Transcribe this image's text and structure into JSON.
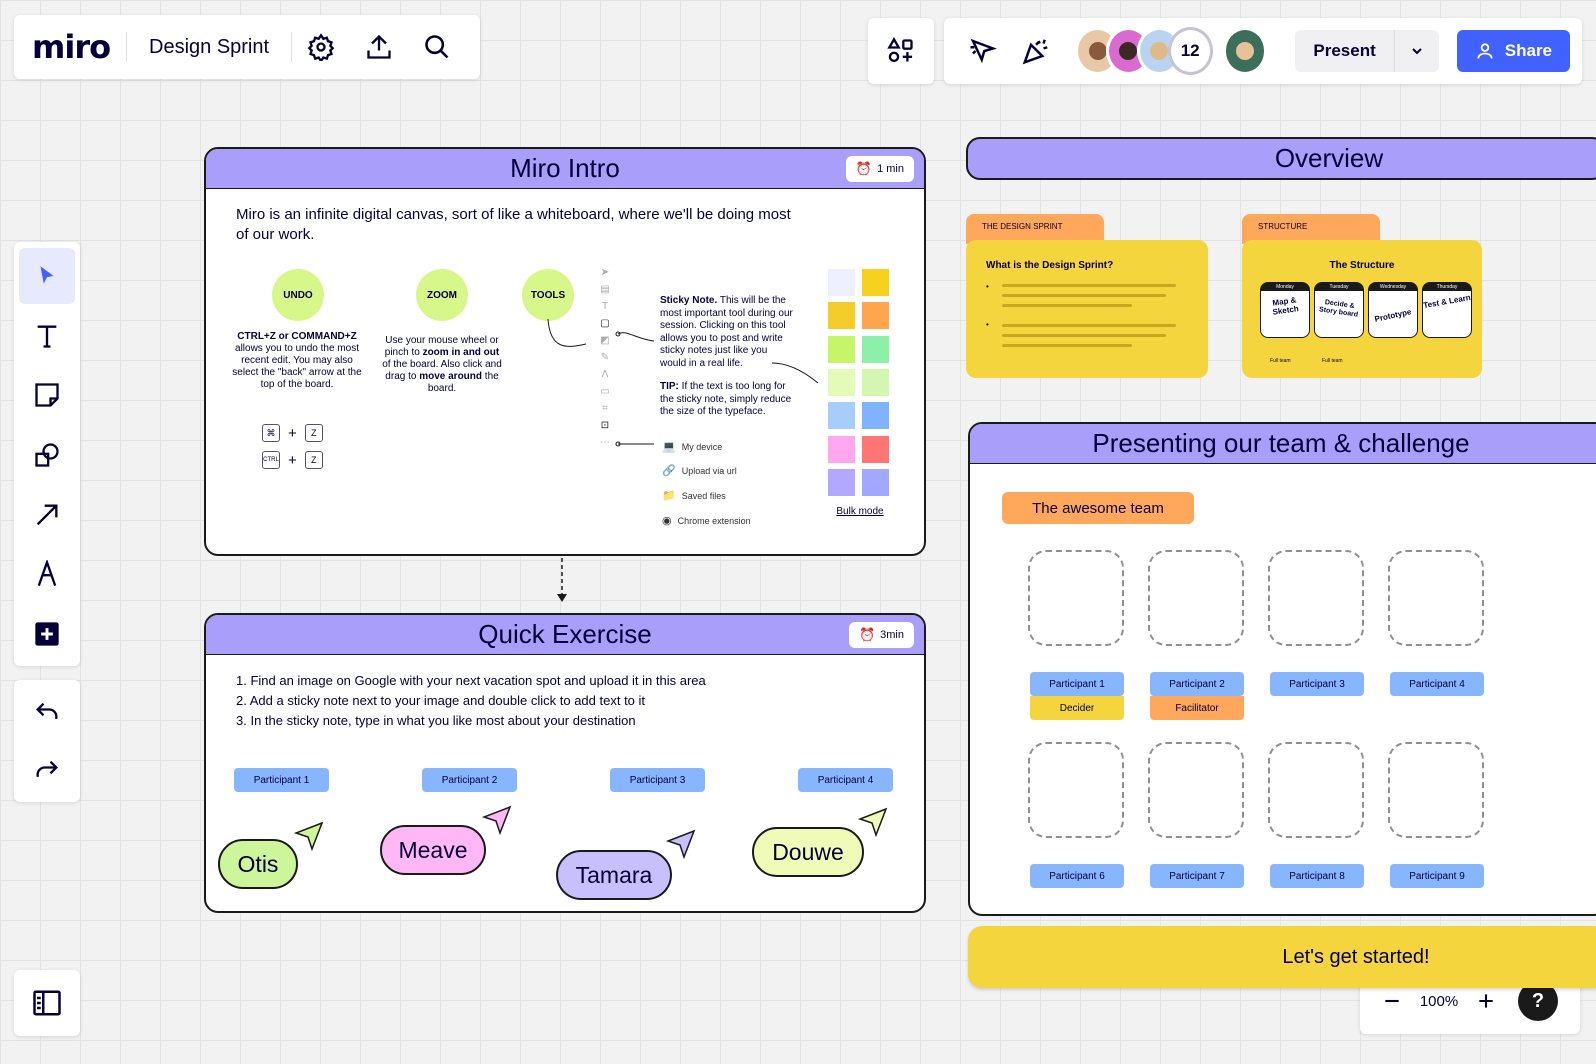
{
  "app": {
    "logo": "miro",
    "board_title": "Design Sprint"
  },
  "header": {
    "participant_count": "12",
    "present_label": "Present",
    "share_label": "Share"
  },
  "zoom": {
    "level": "100%",
    "help": "?"
  },
  "intro_frame": {
    "title": "Miro Intro",
    "timer": "1 min",
    "description": "Miro is an infinite digital canvas, sort of like a whiteboard, where we'll be doing most of our work.",
    "undo": {
      "bubble": "UNDO",
      "shortcut": "CTRL+Z or COMMAND+Z",
      "text": "allows you to undo the most recent edit. You may also select the \"back\" arrow at the top of the board.",
      "key_cmd": "⌘",
      "key_ctrl": "CTRL",
      "key_z": "Z",
      "plus": "+"
    },
    "zoom_tool": {
      "bubble": "ZOOM",
      "text_1": "Use your mouse wheel or pinch to ",
      "bold_1": "zoom in and out",
      "text_2": " of the board. Also click and drag to ",
      "bold_2": "move around",
      "text_3": " the board."
    },
    "tools": {
      "bubble": "TOOLS",
      "sticky_title": "Sticky Note.",
      "sticky_text": " This will be the most important tool during our session. Clicking on this tool allows you to post and write sticky notes just like you would in a real life.",
      "tip_title": "TIP:",
      "tip_text": " If the text is too long for the sticky note, simply reduce the size of the typeface."
    },
    "upload_options": [
      "My device",
      "Upload via url",
      "Saved files",
      "Chrome extension"
    ],
    "bulk_mode": "Bulk mode"
  },
  "exercise_frame": {
    "title": "Quick Exercise",
    "timer": "3min",
    "steps": [
      "1. Find an image on Google with your next vacation spot and upload it in this area",
      "2. Add a sticky note next to your image and double click to add text to it",
      "3. In the sticky note, type in what you like most about your destination"
    ],
    "participants": [
      "Participant 1",
      "Participant 2",
      "Participant 3",
      "Participant 4"
    ],
    "cursors": [
      "Otis",
      "Meave",
      "Tamara",
      "Douwe"
    ]
  },
  "overview": {
    "title": "Overview",
    "card1_tab": "THE DESIGN SPRINT",
    "card1_title": "What is the Design Sprint?",
    "card2_tab": "STRUCTURE",
    "card2_title": "The Structure",
    "days": [
      "Monday",
      "Tuesday",
      "Wednesday",
      "Thursday"
    ],
    "day_sketches": [
      "Map & Sketch",
      "Decide & Story board",
      "Prototype",
      "Test & Learn"
    ],
    "day_footers": [
      "Full team",
      "Full team"
    ]
  },
  "team_frame": {
    "title": "Presenting our team & challenge",
    "team_label": "The awesome team",
    "participants_row1": [
      "Participant 1",
      "Participant 2",
      "Participant 3",
      "Participant 4"
    ],
    "roles": [
      "Decider",
      "Facilitator"
    ],
    "participants_row2": [
      "Participant 6",
      "Participant 7",
      "Participant 8",
      "Participant 9"
    ]
  },
  "cta": {
    "label": "Let's get started!"
  },
  "colors": {
    "accent": "#4262ff",
    "frame_header": "#a99ffb",
    "yellow": "#f5d53e",
    "orange": "#ffa85c",
    "participant_blue": "#87b5ff",
    "green_bubble": "#d8f78a"
  }
}
